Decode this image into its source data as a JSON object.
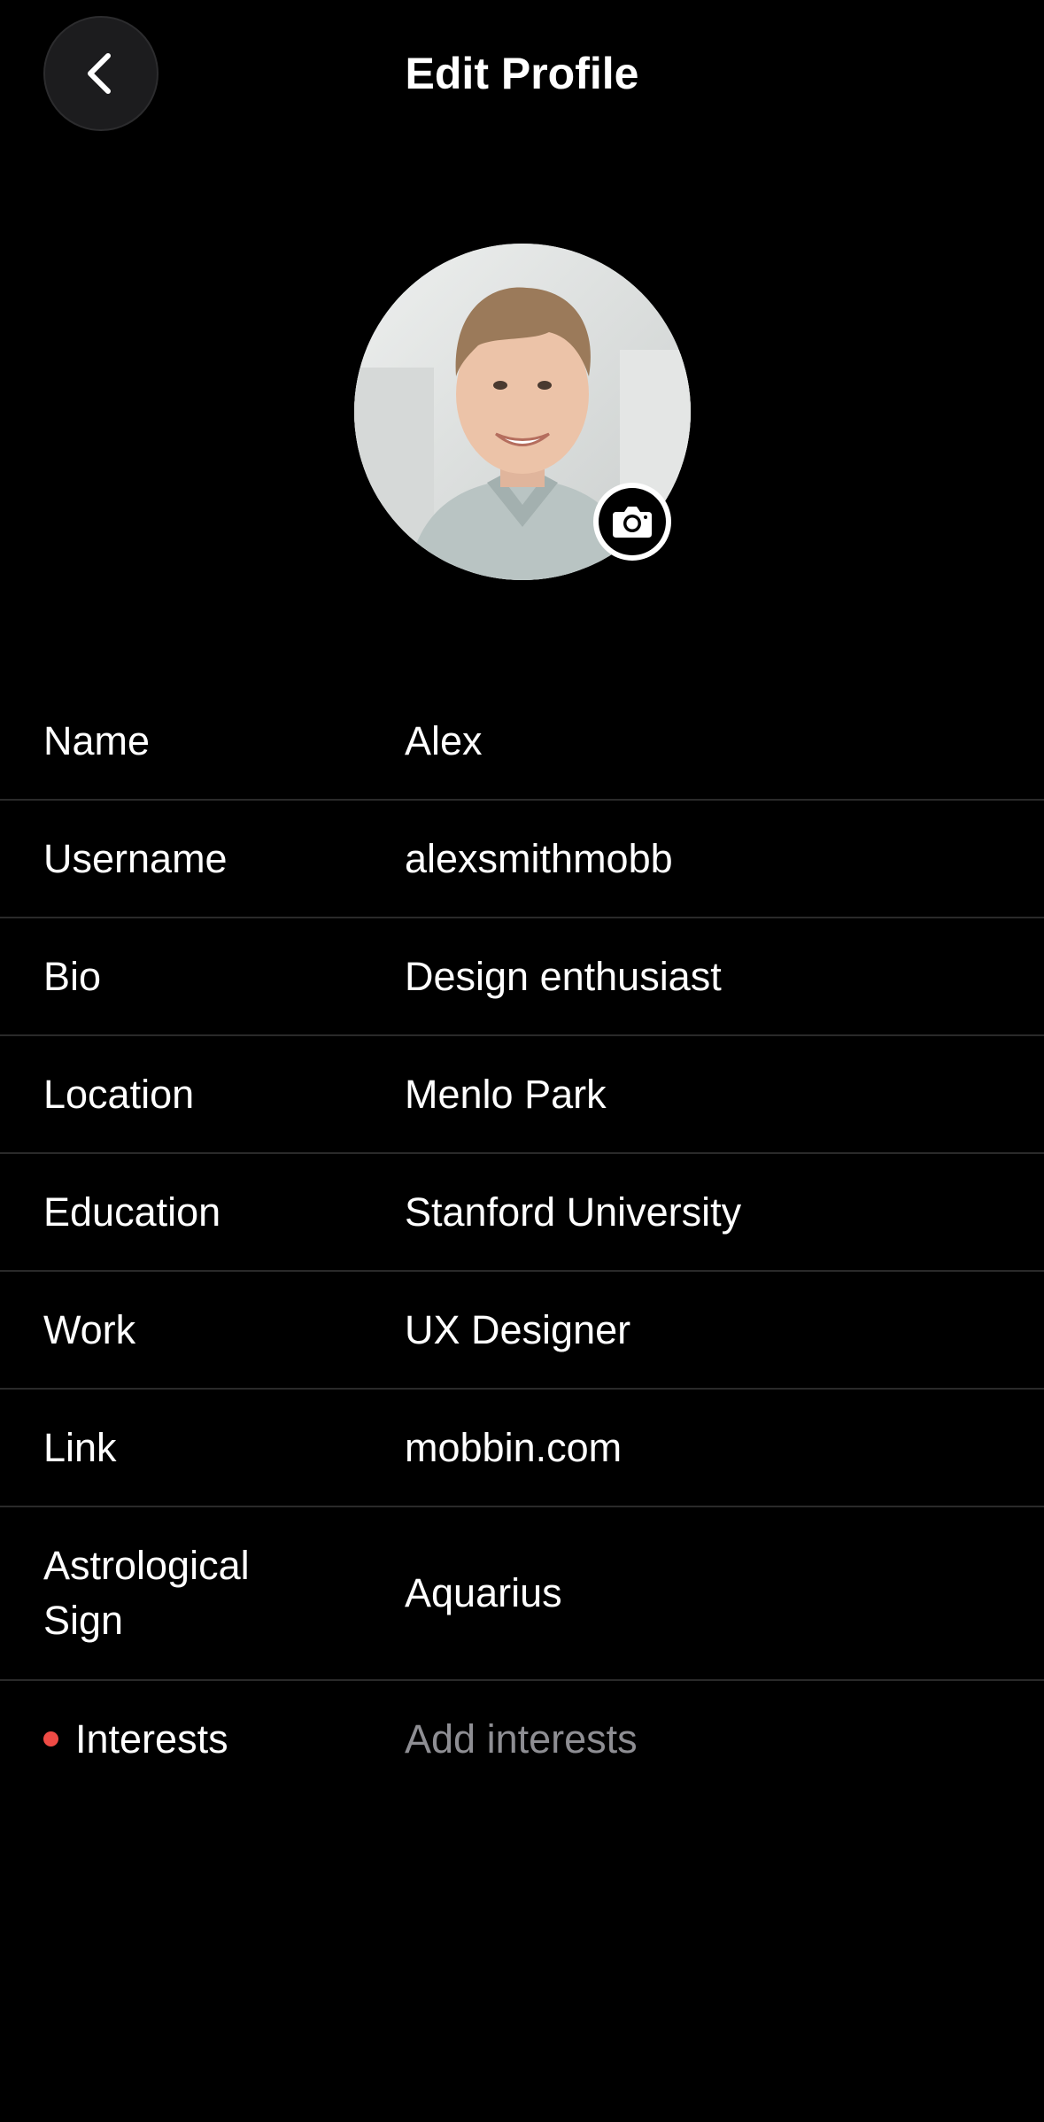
{
  "header": {
    "title": "Edit Profile",
    "back_icon": "chevron-left-icon"
  },
  "avatar": {
    "description_icon": "camera-icon"
  },
  "fields": [
    {
      "label": "Name",
      "value": "Alex"
    },
    {
      "label": "Username",
      "value": "alexsmithmobb"
    },
    {
      "label": "Bio",
      "value": "Design enthusiast"
    },
    {
      "label": "Location",
      "value": "Menlo Park"
    },
    {
      "label": "Education",
      "value": "Stanford University"
    },
    {
      "label": "Work",
      "value": "UX Designer"
    },
    {
      "label": "Link",
      "value": "mobbin.com"
    },
    {
      "label": "Astrological Sign",
      "value": "Aquarius"
    },
    {
      "label": "Interests",
      "placeholder": "Add interests",
      "required": true
    }
  ],
  "colors": {
    "background": "#000000",
    "text": "#ffffff",
    "placeholder": "#8e8e93",
    "required_dot": "#ef4b45",
    "divider": "#2a2a2a",
    "back_button": "#1c1c1e"
  }
}
